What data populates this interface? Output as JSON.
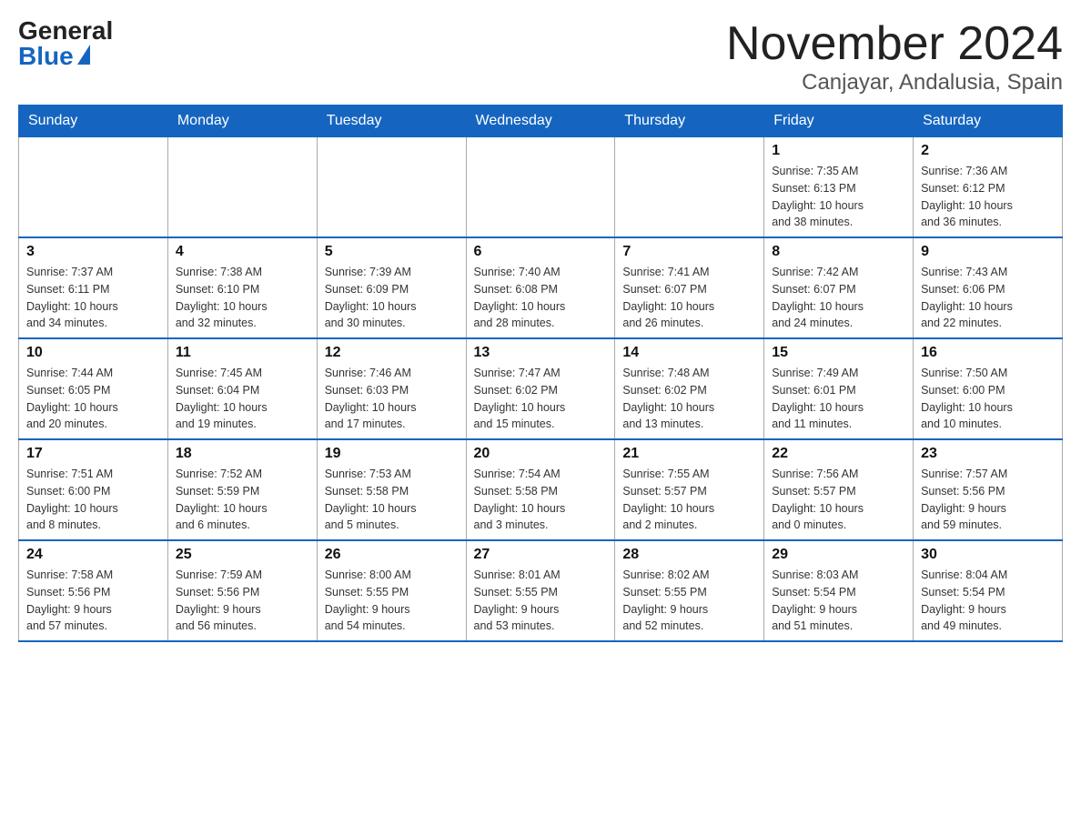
{
  "header": {
    "logo_general": "General",
    "logo_blue": "Blue",
    "main_title": "November 2024",
    "subtitle": "Canjayar, Andalusia, Spain"
  },
  "weekdays": [
    "Sunday",
    "Monday",
    "Tuesday",
    "Wednesday",
    "Thursday",
    "Friday",
    "Saturday"
  ],
  "weeks": [
    [
      {
        "day": "",
        "info": ""
      },
      {
        "day": "",
        "info": ""
      },
      {
        "day": "",
        "info": ""
      },
      {
        "day": "",
        "info": ""
      },
      {
        "day": "",
        "info": ""
      },
      {
        "day": "1",
        "info": "Sunrise: 7:35 AM\nSunset: 6:13 PM\nDaylight: 10 hours\nand 38 minutes."
      },
      {
        "day": "2",
        "info": "Sunrise: 7:36 AM\nSunset: 6:12 PM\nDaylight: 10 hours\nand 36 minutes."
      }
    ],
    [
      {
        "day": "3",
        "info": "Sunrise: 7:37 AM\nSunset: 6:11 PM\nDaylight: 10 hours\nand 34 minutes."
      },
      {
        "day": "4",
        "info": "Sunrise: 7:38 AM\nSunset: 6:10 PM\nDaylight: 10 hours\nand 32 minutes."
      },
      {
        "day": "5",
        "info": "Sunrise: 7:39 AM\nSunset: 6:09 PM\nDaylight: 10 hours\nand 30 minutes."
      },
      {
        "day": "6",
        "info": "Sunrise: 7:40 AM\nSunset: 6:08 PM\nDaylight: 10 hours\nand 28 minutes."
      },
      {
        "day": "7",
        "info": "Sunrise: 7:41 AM\nSunset: 6:07 PM\nDaylight: 10 hours\nand 26 minutes."
      },
      {
        "day": "8",
        "info": "Sunrise: 7:42 AM\nSunset: 6:07 PM\nDaylight: 10 hours\nand 24 minutes."
      },
      {
        "day": "9",
        "info": "Sunrise: 7:43 AM\nSunset: 6:06 PM\nDaylight: 10 hours\nand 22 minutes."
      }
    ],
    [
      {
        "day": "10",
        "info": "Sunrise: 7:44 AM\nSunset: 6:05 PM\nDaylight: 10 hours\nand 20 minutes."
      },
      {
        "day": "11",
        "info": "Sunrise: 7:45 AM\nSunset: 6:04 PM\nDaylight: 10 hours\nand 19 minutes."
      },
      {
        "day": "12",
        "info": "Sunrise: 7:46 AM\nSunset: 6:03 PM\nDaylight: 10 hours\nand 17 minutes."
      },
      {
        "day": "13",
        "info": "Sunrise: 7:47 AM\nSunset: 6:02 PM\nDaylight: 10 hours\nand 15 minutes."
      },
      {
        "day": "14",
        "info": "Sunrise: 7:48 AM\nSunset: 6:02 PM\nDaylight: 10 hours\nand 13 minutes."
      },
      {
        "day": "15",
        "info": "Sunrise: 7:49 AM\nSunset: 6:01 PM\nDaylight: 10 hours\nand 11 minutes."
      },
      {
        "day": "16",
        "info": "Sunrise: 7:50 AM\nSunset: 6:00 PM\nDaylight: 10 hours\nand 10 minutes."
      }
    ],
    [
      {
        "day": "17",
        "info": "Sunrise: 7:51 AM\nSunset: 6:00 PM\nDaylight: 10 hours\nand 8 minutes."
      },
      {
        "day": "18",
        "info": "Sunrise: 7:52 AM\nSunset: 5:59 PM\nDaylight: 10 hours\nand 6 minutes."
      },
      {
        "day": "19",
        "info": "Sunrise: 7:53 AM\nSunset: 5:58 PM\nDaylight: 10 hours\nand 5 minutes."
      },
      {
        "day": "20",
        "info": "Sunrise: 7:54 AM\nSunset: 5:58 PM\nDaylight: 10 hours\nand 3 minutes."
      },
      {
        "day": "21",
        "info": "Sunrise: 7:55 AM\nSunset: 5:57 PM\nDaylight: 10 hours\nand 2 minutes."
      },
      {
        "day": "22",
        "info": "Sunrise: 7:56 AM\nSunset: 5:57 PM\nDaylight: 10 hours\nand 0 minutes."
      },
      {
        "day": "23",
        "info": "Sunrise: 7:57 AM\nSunset: 5:56 PM\nDaylight: 9 hours\nand 59 minutes."
      }
    ],
    [
      {
        "day": "24",
        "info": "Sunrise: 7:58 AM\nSunset: 5:56 PM\nDaylight: 9 hours\nand 57 minutes."
      },
      {
        "day": "25",
        "info": "Sunrise: 7:59 AM\nSunset: 5:56 PM\nDaylight: 9 hours\nand 56 minutes."
      },
      {
        "day": "26",
        "info": "Sunrise: 8:00 AM\nSunset: 5:55 PM\nDaylight: 9 hours\nand 54 minutes."
      },
      {
        "day": "27",
        "info": "Sunrise: 8:01 AM\nSunset: 5:55 PM\nDaylight: 9 hours\nand 53 minutes."
      },
      {
        "day": "28",
        "info": "Sunrise: 8:02 AM\nSunset: 5:55 PM\nDaylight: 9 hours\nand 52 minutes."
      },
      {
        "day": "29",
        "info": "Sunrise: 8:03 AM\nSunset: 5:54 PM\nDaylight: 9 hours\nand 51 minutes."
      },
      {
        "day": "30",
        "info": "Sunrise: 8:04 AM\nSunset: 5:54 PM\nDaylight: 9 hours\nand 49 minutes."
      }
    ]
  ]
}
